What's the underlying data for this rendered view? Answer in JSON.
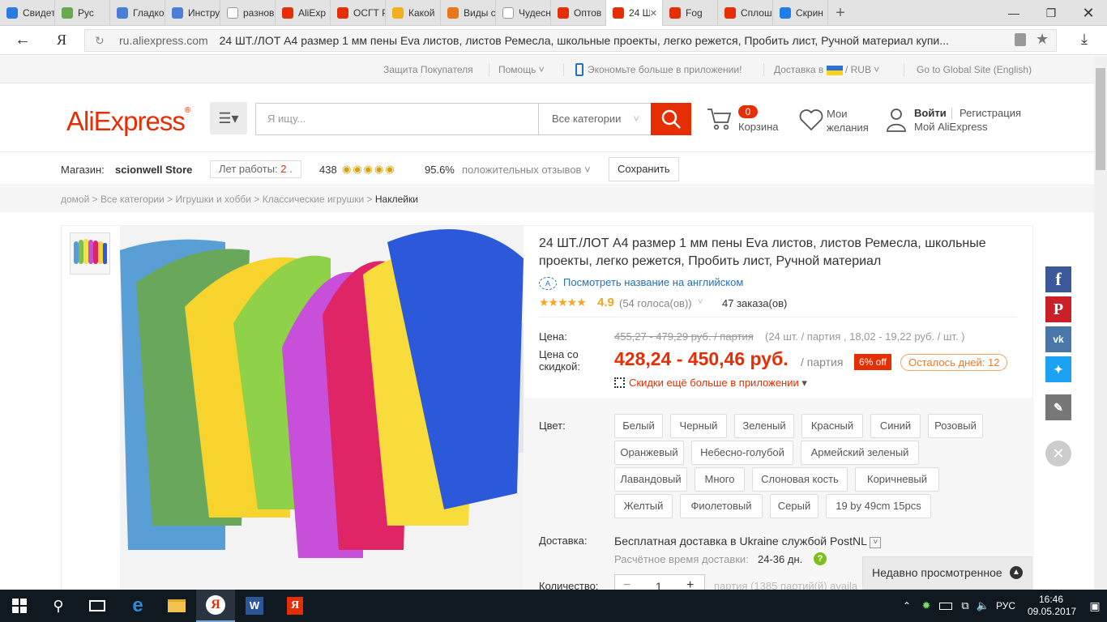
{
  "browser": {
    "tabs": [
      {
        "label": "Свидет",
        "icon": "text-icon",
        "color": "#2a7ae2"
      },
      {
        "label": "Рус",
        "icon": "fm-icon",
        "color": "#6aa84f"
      },
      {
        "label": "Гладко",
        "icon": "docs-icon",
        "color": "#4a7fd8"
      },
      {
        "label": "Инстру",
        "icon": "docs-icon",
        "color": "#4a7fd8"
      },
      {
        "label": "разнов",
        "icon": "yandex-icon",
        "color": "#ffffff"
      },
      {
        "label": "AliExp",
        "icon": "aliexpress-icon",
        "color": "#e62e04"
      },
      {
        "label": "ОСГТ Р",
        "icon": "aliexpress-icon",
        "color": "#e62e04"
      },
      {
        "label": "Какой",
        "icon": "smile-icon",
        "color": "#f2b01e"
      },
      {
        "label": "Виды с",
        "icon": "photo-icon",
        "color": "#e8781a"
      },
      {
        "label": "Чудесн",
        "icon": "page-icon",
        "color": "#ffffff"
      },
      {
        "label": "Оптов",
        "icon": "aliexpress-icon",
        "color": "#e62e04"
      },
      {
        "label": "24 Ш",
        "icon": "aliexpress-icon",
        "color": "#e62e04"
      },
      {
        "label": "Fog",
        "icon": "aliexpress-icon",
        "color": "#e62e04"
      },
      {
        "label": "Сплош",
        "icon": "aliexpress-icon",
        "color": "#e62e04"
      },
      {
        "label": "Скрин",
        "icon": "dropbox-icon",
        "color": "#1e7de6"
      }
    ],
    "active_tab": 11,
    "url_domain": "ru.aliexpress.com",
    "url_title": "24 ШТ./ЛОТ А4 размер 1 мм пены Eva листов, листов Ремесла, школьные проекты, легко режется, Пробить лист, Ручной материал купи..."
  },
  "topnav": {
    "protection": "Защита Покупателя",
    "help": "Помощь",
    "app": "Экономьте больше в приложении!",
    "delivery": "Доставка в",
    "currency": "RUB",
    "global": "Go to Global Site (English)"
  },
  "header": {
    "logo": "AliExpress",
    "search_placeholder": "Я ищу...",
    "all_categories": "Все категории",
    "cart_count": "0",
    "cart_label": "Корзина",
    "wishlist_1": "Мои",
    "wishlist_2": "желания",
    "login": "Войти",
    "register": "Регистрация",
    "my_ali": "Мой AliExpress"
  },
  "store": {
    "label": "Магазин:",
    "name": "scionwell Store",
    "years_label": "Лет работы:",
    "years": "2",
    "score": "438",
    "positive_pct": "95.6%",
    "positive_label": "положительных отзывов",
    "save": "Сохранить"
  },
  "breadcrumbs": [
    "домой",
    "Все категории",
    "Игрушки и хобби",
    "Классические игрушки",
    "Наклейки"
  ],
  "product": {
    "title": "24 ШТ./ЛОТ А4 размер 1 мм пены Eva листов, листов Ремесла, школьные проекты, легко режется, Пробить лист, Ручной материал",
    "translate_link": "Посмотреть название на английском",
    "rating": "4.9",
    "votes": "(54 голоса(ов))",
    "orders": "47 заказа(ов)",
    "price_label": "Цена:",
    "old_price": "455,27 - 479,29 руб. / партия",
    "old_price_note": "(24 шт. / партия , 18,02 - 19,22 руб. / шт. )",
    "discount_label_1": "Цена со",
    "discount_label_2": "скидкой:",
    "price": "428,24 - 450,46 руб.",
    "price_unit": "/ партия",
    "discount_badge": "6% off",
    "days_left": "Осталось дней: 12",
    "app_discount": "Скидки ещё больше в приложении",
    "color_label": "Цвет:",
    "colors": [
      "Белый",
      "Черный",
      "Зеленый",
      "Красный",
      "Синий",
      "Розовый",
      "Оранжевый",
      "Небесно-голубой",
      "Армейский зеленый",
      "Лавандовый",
      "Много",
      "Слоновая кость",
      "Коричневый",
      "Желтый",
      "Фиолетовый",
      "Серый",
      "19 by 49cm 15pcs"
    ],
    "delivery_label": "Доставка:",
    "delivery_text": "Бесплатная доставка в Ukraine службой PostNL",
    "delivery_time_label": "Расчётное время доставки:",
    "delivery_time": "24-36 дн.",
    "qty_label": "Количество:",
    "qty": "1",
    "qty_note": "партия (1385 партий(й) availa"
  },
  "recently_viewed": "Недавно просмотренное",
  "taskbar": {
    "lang": "РУС",
    "time": "16:46",
    "date": "09.05.2017"
  },
  "colors": {
    "accent": "#e62e04",
    "price": "#e62e04",
    "link": "#2272b6"
  }
}
